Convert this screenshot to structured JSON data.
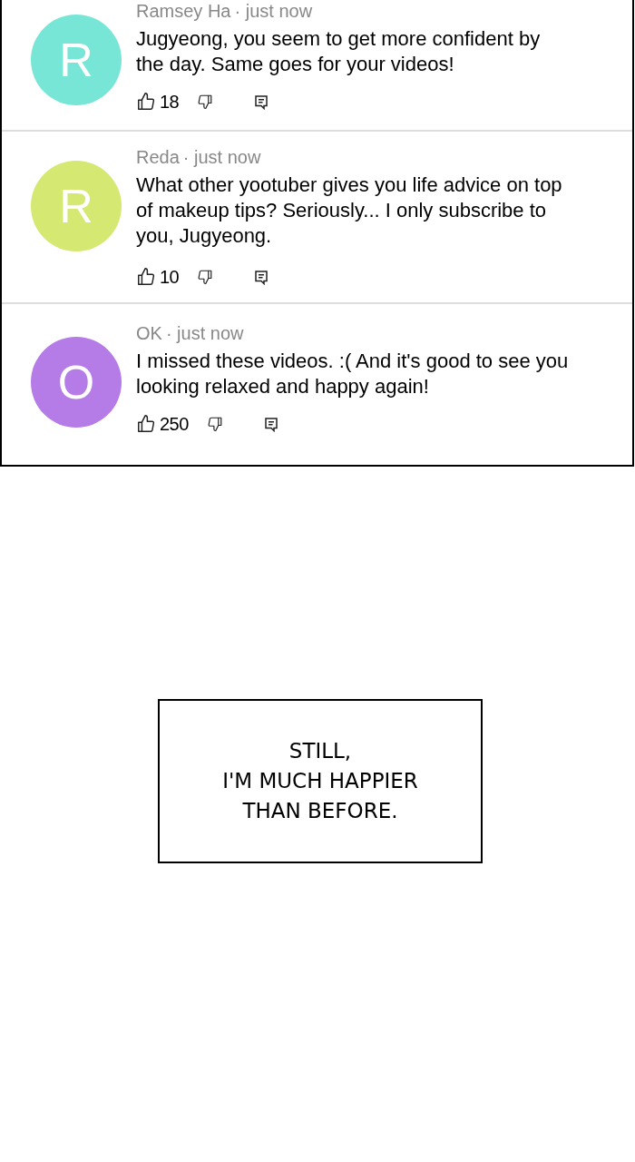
{
  "comments": [
    {
      "initial": "R",
      "color": "#78e6d6",
      "author": "Ramsey Ha",
      "time": "· just now",
      "text": "Jugyeong, you seem to get more confident by the day. Same goes for your videos!",
      "likes": "18"
    },
    {
      "initial": "R",
      "color": "#d4e872",
      "author": "Reda",
      "time": "· just now",
      "text": "What other yootuber gives you life advice on top of makeup tips? Seriously... I only subscribe to you, Jugyeong.",
      "likes": "10"
    },
    {
      "initial": "O",
      "color": "#b57be6",
      "author": "OK",
      "time": "· just now",
      "text": "I missed these videos. :( And it's good to see you looking relaxed and happy again!",
      "likes": "250"
    }
  ],
  "caption": [
    "STILL,",
    "I'M MUCH HAPPIER",
    "THAN BEFORE."
  ]
}
